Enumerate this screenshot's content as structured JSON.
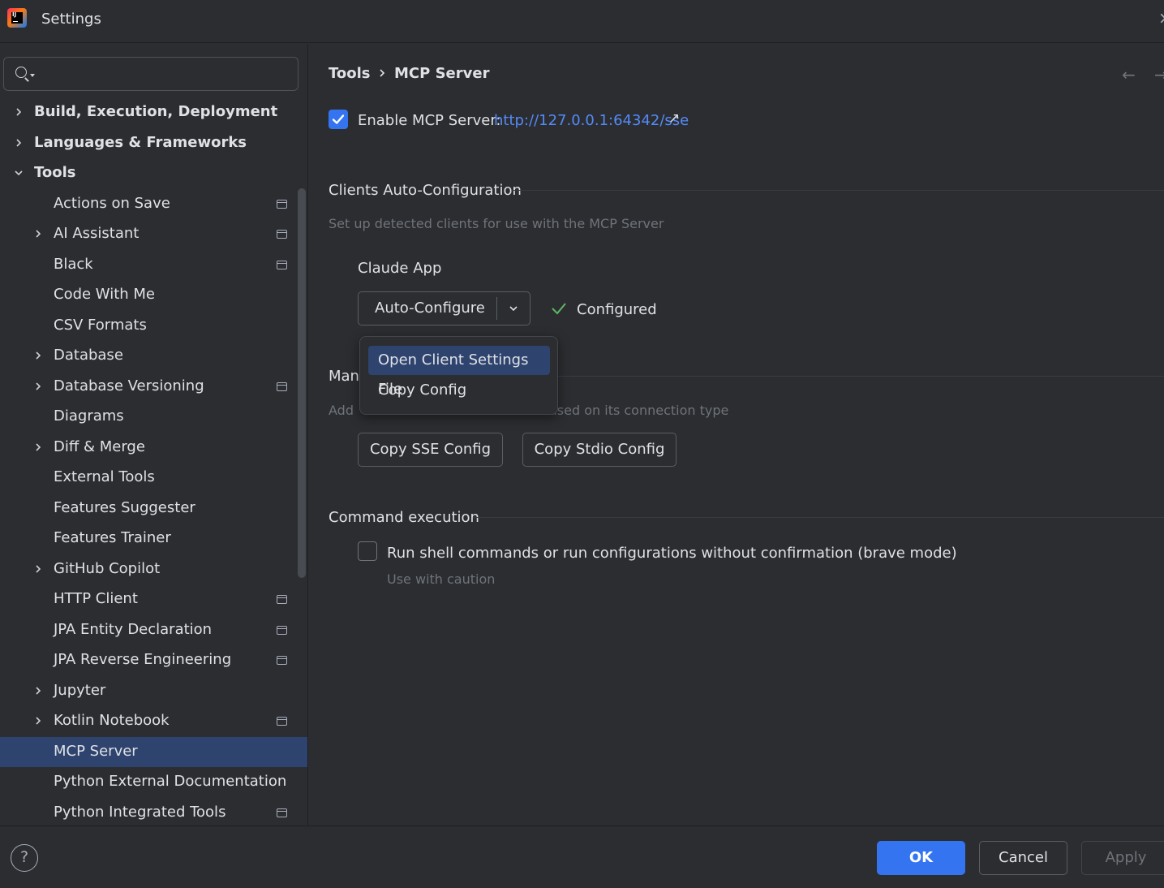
{
  "window": {
    "title": "Settings"
  },
  "search": {
    "placeholder": "",
    "value": ""
  },
  "sidebar": {
    "items": [
      {
        "label": "Build, Execution, Deployment",
        "level": 0,
        "chevron": "right",
        "project": false
      },
      {
        "label": "Languages & Frameworks",
        "level": 0,
        "chevron": "right",
        "project": false
      },
      {
        "label": "Tools",
        "level": 0,
        "chevron": "down",
        "project": false
      },
      {
        "label": "Actions on Save",
        "level": 1,
        "chevron": "none",
        "project": true
      },
      {
        "label": "AI Assistant",
        "level": 1,
        "chevron": "right",
        "project": true
      },
      {
        "label": "Black",
        "level": 1,
        "chevron": "none",
        "project": true
      },
      {
        "label": "Code With Me",
        "level": 1,
        "chevron": "none",
        "project": false
      },
      {
        "label": "CSV Formats",
        "level": 1,
        "chevron": "none",
        "project": false
      },
      {
        "label": "Database",
        "level": 1,
        "chevron": "right",
        "project": false
      },
      {
        "label": "Database Versioning",
        "level": 1,
        "chevron": "right",
        "project": true
      },
      {
        "label": "Diagrams",
        "level": 1,
        "chevron": "none",
        "project": false
      },
      {
        "label": "Diff & Merge",
        "level": 1,
        "chevron": "right",
        "project": false
      },
      {
        "label": "External Tools",
        "level": 1,
        "chevron": "none",
        "project": false
      },
      {
        "label": "Features Suggester",
        "level": 1,
        "chevron": "none",
        "project": false
      },
      {
        "label": "Features Trainer",
        "level": 1,
        "chevron": "none",
        "project": false
      },
      {
        "label": "GitHub Copilot",
        "level": 1,
        "chevron": "right",
        "project": false
      },
      {
        "label": "HTTP Client",
        "level": 1,
        "chevron": "none",
        "project": true
      },
      {
        "label": "JPA Entity Declaration",
        "level": 1,
        "chevron": "none",
        "project": true
      },
      {
        "label": "JPA Reverse Engineering",
        "level": 1,
        "chevron": "none",
        "project": true
      },
      {
        "label": "Jupyter",
        "level": 1,
        "chevron": "right",
        "project": false
      },
      {
        "label": "Kotlin Notebook",
        "level": 1,
        "chevron": "right",
        "project": true
      },
      {
        "label": "MCP Server",
        "level": 1,
        "chevron": "none",
        "project": false,
        "selected": true
      },
      {
        "label": "Python External Documentation",
        "level": 1,
        "chevron": "none",
        "project": false
      },
      {
        "label": "Python Integrated Tools",
        "level": 1,
        "chevron": "none",
        "project": true
      }
    ]
  },
  "breadcrumb": {
    "parent": "Tools",
    "current": "MCP Server"
  },
  "enable": {
    "checked": true,
    "label": "Enable MCP Server:",
    "url": "http://127.0.0.1:64342/sse"
  },
  "auto_config": {
    "title": "Clients Auto-Configuration",
    "description": "Set up detected clients for use with the MCP Server",
    "client_name": "Claude App",
    "button_label": "Auto-Configure",
    "status": "Configured"
  },
  "popup": {
    "items": [
      "Open Client Settings File",
      "Copy Config"
    ],
    "active_index": 0
  },
  "manual": {
    "title_visible": "Man",
    "description_left": "Add",
    "description_right": "ased on its connection type",
    "sse_button": "Copy SSE Config",
    "stdio_button": "Copy Stdio Config"
  },
  "command": {
    "title": "Command execution",
    "checked": false,
    "label": "Run shell commands or run configurations without confirmation (brave mode)",
    "hint": "Use with caution"
  },
  "footer": {
    "help": "?",
    "ok": "OK",
    "cancel": "Cancel",
    "apply": "Apply"
  },
  "colors": {
    "accent": "#3574f0",
    "selection": "#2e436e",
    "link": "#548af7",
    "status_ok": "#5fb865"
  }
}
